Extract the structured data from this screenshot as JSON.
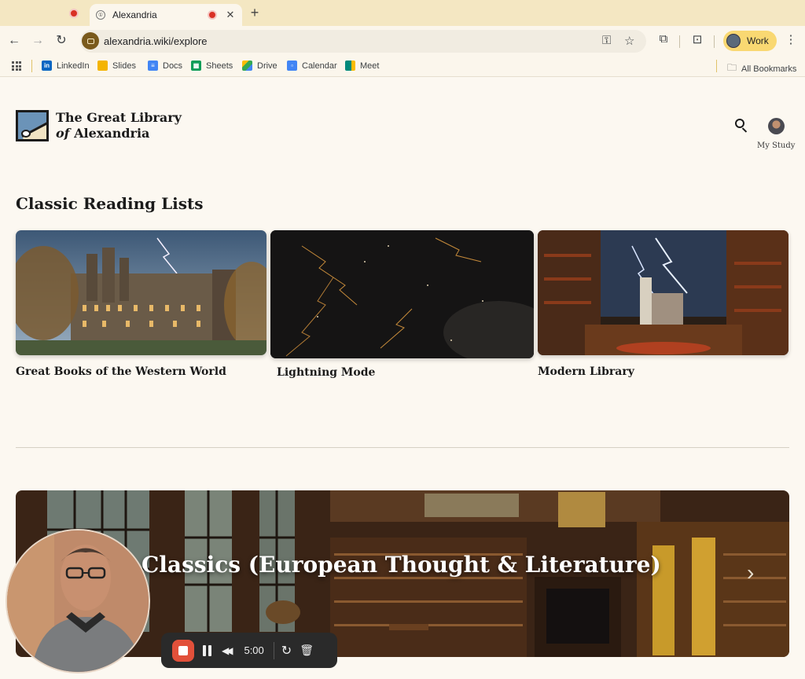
{
  "browser": {
    "tab_title": "Alexandria",
    "url": "alexandria.wiki/explore",
    "profile_label": "Work",
    "bookmarks": [
      {
        "label": "LinkedIn",
        "icon": "linkedin-icon",
        "color": "#0a66c2"
      },
      {
        "label": "Slides",
        "icon": "slides-icon",
        "color": "#f4b400"
      },
      {
        "label": "Docs",
        "icon": "docs-icon",
        "color": "#4285f4"
      },
      {
        "label": "Sheets",
        "icon": "sheets-icon",
        "color": "#0f9d58"
      },
      {
        "label": "Drive",
        "icon": "drive-icon",
        "color": "#1fa463"
      },
      {
        "label": "Calendar",
        "icon": "calendar-icon",
        "color": "#4285f4"
      },
      {
        "label": "Meet",
        "icon": "meet-icon",
        "color": "#00897b"
      }
    ],
    "all_bookmarks_label": "All Bookmarks"
  },
  "header": {
    "brand_line1": "The Great Library",
    "brand_line2_italic": "of",
    "brand_line2_rest": " Alexandria",
    "study_label": "My Study"
  },
  "reading_lists": {
    "title": "Classic Reading Lists",
    "cards": [
      {
        "label": "Great Books of the Western World"
      },
      {
        "label": "Lightning Mode"
      },
      {
        "label": "Modern Library"
      }
    ]
  },
  "hero": {
    "title": "Classics (European Thought & Literature)"
  },
  "recorder": {
    "time": "5:00"
  },
  "colors": {
    "page_bg": "#fcf8f1",
    "tabbar_bg": "#f4e7c2",
    "profile_chip": "#f9d872",
    "record_red": "#e2503a"
  }
}
